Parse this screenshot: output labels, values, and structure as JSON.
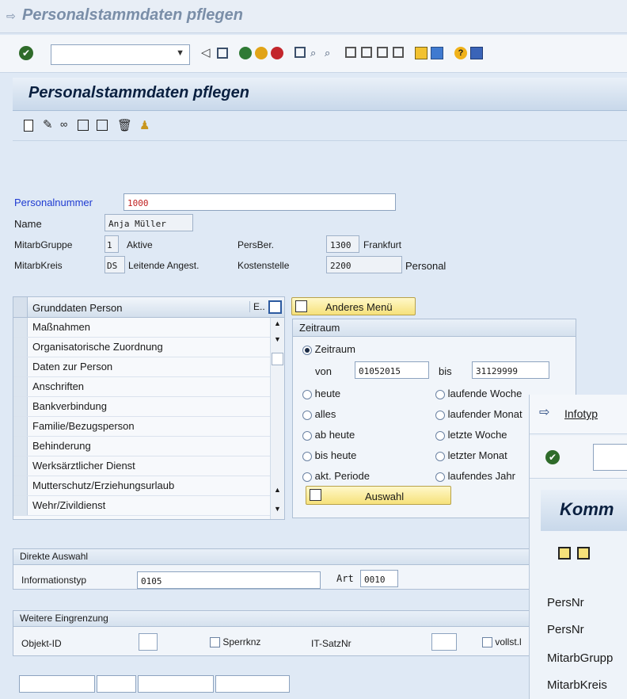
{
  "window": {
    "title": "Personalstammdaten pflegen"
  },
  "toolbar": {
    "command_value": ""
  },
  "panel": {
    "title": "Personalstammdaten pflegen"
  },
  "header": {
    "personalnummer_label": "Personalnummer",
    "personalnummer_value": "1000",
    "name_label": "Name",
    "name_value": "Anja Müller",
    "mitarbgruppe_label": "MitarbGruppe",
    "mitarbgruppe_code": "1",
    "mitarbgruppe_text": "Aktive",
    "persber_label": "PersBer.",
    "persber_code": "1300",
    "persber_text": "Frankfurt",
    "mitarbkreis_label": "MitarbKreis",
    "mitarbkreis_code": "DS",
    "mitarbkreis_text": "Leitende Angest.",
    "kostenstelle_label": "Kostenstelle",
    "kostenstelle_code": "2200",
    "kostenstelle_text": "Personal"
  },
  "infotypes": {
    "column_header": "Grunddaten Person",
    "column_e": "E..",
    "rows": [
      "Maßnahmen",
      "Organisatorische Zuordnung",
      "Daten zur Person",
      "Anschriften",
      "Bankverbindung",
      "Familie/Bezugsperson",
      "Behinderung",
      "Werksärztlicher Dienst",
      "Mutterschutz/Erziehungsurlaub",
      "Wehr/Zivildienst"
    ]
  },
  "menu_button": {
    "label": "Anderes Menü"
  },
  "zeitraum": {
    "title": "Zeitraum",
    "option_zeitraum": "Zeitraum",
    "von_label": "von",
    "von_value": "01052015",
    "bis_label": "bis",
    "bis_value": "31129999",
    "options_left": [
      "heute",
      "alles",
      "ab heute",
      "bis heute",
      "akt. Periode"
    ],
    "options_right": [
      "laufende Woche",
      "laufender Monat",
      "letzte Woche",
      "letzter Monat",
      "laufendes Jahr"
    ],
    "auswahl_label": "Auswahl"
  },
  "direkte_auswahl": {
    "title": "Direkte Auswahl",
    "informationstyp_label": "Informationstyp",
    "informationstyp_value": "0105",
    "art_label": "Art",
    "art_value": "0010"
  },
  "weitere": {
    "title": "Weitere Eingrenzung",
    "objekt_label": "Objekt-ID",
    "sperrknz_label": "Sperrknz",
    "itsatz_label": "IT-SatzNr",
    "vollst_label": "vollst.l"
  },
  "overlay": {
    "title": "Infotyp",
    "panel_title": "Komm",
    "rows": [
      "PersNr",
      "PersNr",
      "MitarbGrupp",
      "MitarbKreis"
    ]
  }
}
